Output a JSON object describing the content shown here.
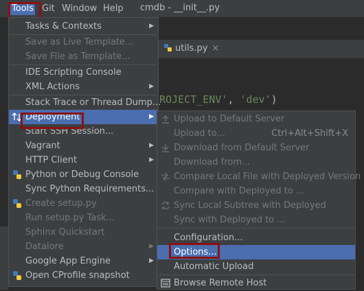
{
  "menubar": {
    "items": [
      "Tools",
      "Git",
      "Window",
      "Help"
    ],
    "window_title": "cmdb - __init__.py"
  },
  "editor": {
    "tab_label": "utils.py",
    "tab_close": "×",
    "code_line": "ROJECT_ENV', 'dev')",
    "code_string_a": "ROJECT_ENV'",
    "code_sep": ", ",
    "code_string_b": "'dev'",
    "code_close": ")"
  },
  "tools_menu": {
    "items": [
      {
        "label": "Tasks & Contexts",
        "submenu": true
      },
      {
        "label": "Save as Live Template...",
        "disabled": true
      },
      {
        "label": "Save File as Template...",
        "disabled": true
      },
      {
        "label": "IDE Scripting Console"
      },
      {
        "label": "XML Actions",
        "submenu": true
      },
      {
        "label": "Stack Trace or Thread Dump..."
      },
      {
        "label": "Deployment",
        "submenu": true,
        "highlighted": true,
        "icon": "deployment-icon"
      },
      {
        "label": "Start SSH Session..."
      },
      {
        "label": "Vagrant",
        "submenu": true
      },
      {
        "label": "HTTP Client",
        "submenu": true
      },
      {
        "label": "Python or Debug Console",
        "icon": "python-icon"
      },
      {
        "label": "Sync Python Requirements..."
      },
      {
        "label": "Create setup.py",
        "disabled": true,
        "icon": "python-icon"
      },
      {
        "label": "Run setup.py Task...",
        "disabled": true
      },
      {
        "label": "Sphinx Quickstart",
        "disabled": true
      },
      {
        "label": "Datalore",
        "submenu": true,
        "disabled": true
      },
      {
        "label": "Google App Engine",
        "submenu": true
      },
      {
        "label": "Open CProfile snapshot",
        "icon": "python-icon"
      }
    ]
  },
  "deployment_menu": {
    "items": [
      {
        "label": "Upload to Default Server",
        "disabled": true,
        "icon": "upload-icon"
      },
      {
        "label": "Upload to...",
        "disabled": true,
        "shortcut": "Ctrl+Alt+Shift+X"
      },
      {
        "label": "Download from Default Server",
        "disabled": true,
        "icon": "download-icon"
      },
      {
        "label": "Download from...",
        "disabled": true
      },
      {
        "label": "Compare Local File with Deployed Version",
        "disabled": true,
        "icon": "compare-icon"
      },
      {
        "label": "Compare with Deployed to ...",
        "disabled": true
      },
      {
        "label": "Sync Local Subtree with Deployed",
        "disabled": true,
        "icon": "sync-icon"
      },
      {
        "label": "Sync with Deployed to ...",
        "disabled": true
      },
      {
        "label": "Configuration..."
      },
      {
        "label": "Options...",
        "highlighted": true
      },
      {
        "label": "Automatic Upload"
      },
      {
        "label": "Browse Remote Host",
        "icon": "remote-host-icon"
      }
    ]
  },
  "colors": {
    "menu_bg": "#3c3f41",
    "highlight": "#4b6eaf",
    "annotation_box": "#8b1111",
    "python_blue": "#3e7ab5",
    "python_yellow": "#f5c93a"
  }
}
